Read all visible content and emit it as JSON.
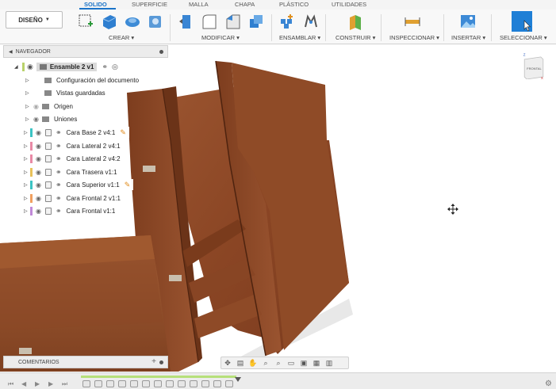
{
  "tabs": [
    {
      "label": "SOLIDO",
      "active": true
    },
    {
      "label": "SUPERFICIE",
      "active": false
    },
    {
      "label": "MALLA",
      "active": false
    },
    {
      "label": "CHAPA",
      "active": false
    },
    {
      "label": "PLÁSTICO",
      "active": false
    },
    {
      "label": "UTILIDADES",
      "active": false
    }
  ],
  "workspace": {
    "label": "DISEÑO"
  },
  "toolbar_groups": [
    {
      "label": "CREAR"
    },
    {
      "label": "MODIFICAR"
    },
    {
      "label": "ENSAMBLAR"
    },
    {
      "label": "CONSTRUIR"
    },
    {
      "label": "INSPECCIONAR"
    },
    {
      "label": "INSERTAR"
    },
    {
      "label": "SELECCIONAR"
    }
  ],
  "navigator": {
    "title": "NAVEGADOR",
    "root": "Ensamble 2 v1",
    "folders": [
      "Configuración del documento",
      "Vistas guardadas",
      "Origen",
      "Uniones"
    ],
    "components": [
      {
        "label": "Cara Base 2 v4:1",
        "color": "#3cc4c4",
        "edit": true
      },
      {
        "label": "Cara Lateral 2 v4:1",
        "color": "#e98aa6",
        "edit": false
      },
      {
        "label": "Cara Lateral 2 v4:2",
        "color": "#e98aa6",
        "edit": false
      },
      {
        "label": "Cara Trasera v1:1",
        "color": "#e9c25a",
        "edit": false
      },
      {
        "label": "Cara Superior v1:1",
        "color": "#3cc4c4",
        "edit": true
      },
      {
        "label": "Cara Frontal 2 v1:1",
        "color": "#f0a060",
        "edit": false
      },
      {
        "label": "Cara Frontal v1:1",
        "color": "#c18ad8",
        "edit": false
      }
    ]
  },
  "viewcube": {
    "face": "FRONTAL",
    "axis_z": "Z",
    "axis_x": "X"
  },
  "comments": {
    "title": "COMENTARIOS"
  },
  "colors": {
    "accent": "#1a73c8",
    "wood": "#8e4a27",
    "wood_dark": "#6b3318",
    "wood_light": "#a85e36"
  }
}
